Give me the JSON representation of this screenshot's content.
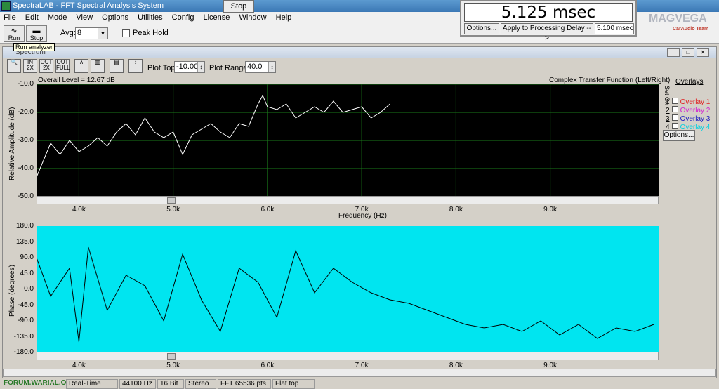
{
  "app": {
    "title": "SpectraLAB - FFT Spectral Analysis System"
  },
  "menu": [
    "File",
    "Edit",
    "Mode",
    "View",
    "Options",
    "Utilities",
    "Config",
    "License",
    "Window",
    "Help"
  ],
  "toolbar": {
    "run_label": "Run",
    "stop_label": "Stop",
    "avg_label": "Avg:",
    "avg_value": "8",
    "peak_hold_label": "Peak Hold",
    "tooltip": "Run analyzer"
  },
  "floating_stop": "Stop",
  "delay_panel": {
    "value": "5.125 msec",
    "options_label": "Options...",
    "apply_label": "Apply to Processing Delay -->",
    "delay_field": "5.100 msec"
  },
  "watermark": {
    "main": "MAGVEGA",
    "sub": "CarAudio Team"
  },
  "spectrum": {
    "window_title": "Spectrum",
    "plot_top_label": "Plot Top:",
    "plot_top_value": "-10.00",
    "plot_range_label": "Plot Range:",
    "plot_range_value": "40.0",
    "overall_level": "Overall Level = 12.67 dB",
    "plot_title": "Complex Transfer Function (Left/Right)",
    "overlays_header": "Overlays",
    "set_on_label": "Set On",
    "overlays": [
      {
        "num": "1",
        "label": "Overlay 1",
        "color": "#e02020"
      },
      {
        "num": "2",
        "label": "Overlay 2",
        "color": "#d020d0"
      },
      {
        "num": "3",
        "label": "Overlay 3",
        "color": "#2020c0"
      },
      {
        "num": "4",
        "label": "Overlay 4",
        "color": "#00d0e0"
      }
    ],
    "overlay_options_label": "Options..."
  },
  "chart_data": [
    {
      "type": "line",
      "ylabel": "Relative Amplitude (dB)",
      "xlabel": "Frequency (Hz)",
      "ylim": [
        -50,
        -10
      ],
      "yticks": [
        "-10.0",
        "-20.0",
        "-30.0",
        "-40.0",
        "-50.0"
      ],
      "xticks": [
        "4.0k",
        "5.0k",
        "6.0k",
        "7.0k",
        "8.0k",
        "9.0k"
      ],
      "xtick_values": [
        4000,
        5000,
        6000,
        7000,
        8000,
        9000
      ],
      "xlim": [
        3550,
        10150
      ],
      "background": "#000000",
      "line_color": "#ffffff",
      "grid_color": "#1a7a1a",
      "series": [
        {
          "x": [
            3550,
            3700,
            3800,
            3900,
            4000,
            4100,
            4200,
            4300,
            4400,
            4500,
            4600,
            4700,
            4800,
            4900,
            5000,
            5100,
            5200,
            5300,
            5400,
            5500,
            5600,
            5700,
            5800,
            5900,
            5950,
            6000,
            6100,
            6200,
            6300,
            6400,
            6500,
            6600,
            6700,
            6800,
            6900,
            7000,
            7100,
            7200,
            7300
          ],
          "y": [
            -43,
            -31,
            -35,
            -30,
            -34,
            -32,
            -29,
            -32,
            -27,
            -24,
            -28,
            -22,
            -27,
            -29,
            -27,
            -35,
            -28,
            -26,
            -24,
            -27,
            -29,
            -24,
            -25,
            -17,
            -14,
            -18,
            -19,
            -17,
            -22,
            -20,
            -18,
            -20,
            -16,
            -20,
            -19,
            -18,
            -22,
            -20,
            -17
          ]
        }
      ]
    },
    {
      "type": "line",
      "ylabel": "Phase (degrees)",
      "ylim": [
        -180,
        180
      ],
      "yticks": [
        "180.0",
        "135.0",
        "90.0",
        "45.0",
        "0.0",
        "-45.0",
        "-90.0",
        "-135.0",
        "-180.0"
      ],
      "xticks": [
        "4.0k",
        "5.0k",
        "6.0k",
        "7.0k",
        "8.0k",
        "9.0k"
      ],
      "xtick_values": [
        4000,
        5000,
        6000,
        7000,
        8000,
        9000
      ],
      "xlim": [
        3550,
        10150
      ],
      "background": "#00e5f0",
      "line_color": "#000000",
      "series": [
        {
          "x": [
            3550,
            3700,
            3900,
            4000,
            4100,
            4300,
            4500,
            4700,
            4900,
            5100,
            5300,
            5500,
            5700,
            5900,
            6100,
            6300,
            6500,
            6700,
            6900,
            7100,
            7300,
            7500,
            7700,
            7900,
            8100,
            8300,
            8500,
            8700,
            8900,
            9100,
            9300,
            9500,
            9700,
            9900,
            10100
          ],
          "y": [
            90,
            -20,
            60,
            -150,
            120,
            -60,
            40,
            10,
            -90,
            100,
            -30,
            -120,
            60,
            20,
            -80,
            110,
            -10,
            60,
            20,
            -10,
            -30,
            -40,
            -60,
            -80,
            -100,
            -110,
            -100,
            -120,
            -90,
            -130,
            -100,
            -140,
            -110,
            -120,
            -100
          ]
        }
      ]
    }
  ],
  "statusbar": [
    "Real-Time",
    "44100 Hz",
    "16 Bit",
    "Stereo",
    "FFT 65536 pts",
    "Flat top"
  ],
  "statusbar_left": "FORUM.WARIAL.ORG"
}
